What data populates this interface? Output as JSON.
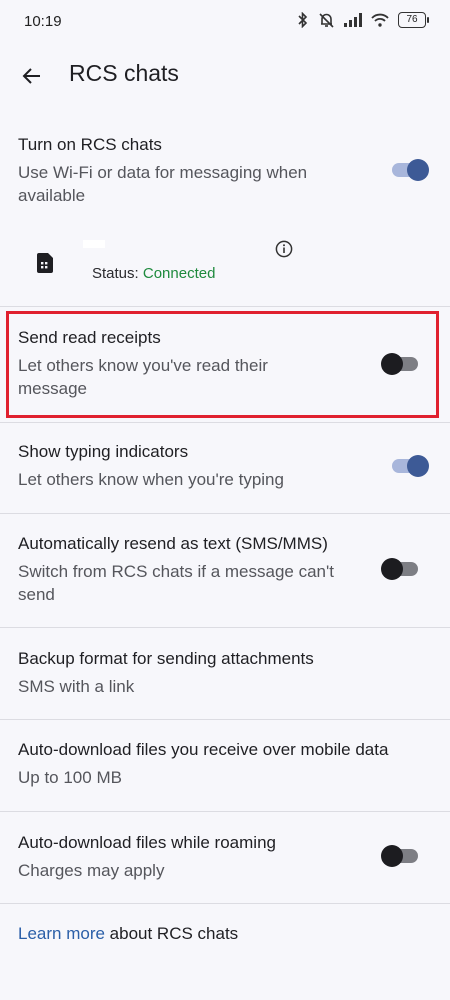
{
  "status_bar": {
    "time": "10:19",
    "battery": "76",
    "icons": [
      "bluetooth-icon",
      "mute-icon",
      "signal-icon",
      "wifi-icon",
      "battery-icon"
    ]
  },
  "appbar": {
    "back_icon": "arrow-back-icon",
    "title": "RCS chats"
  },
  "settings": {
    "rcs": {
      "title": "Turn on RCS chats",
      "subtitle": "Use Wi-Fi or data for messaging when available",
      "enabled": true
    },
    "sim": {
      "icon": "sim-card-icon",
      "status_label": "Status:",
      "status_value": "Connected",
      "info_icon": "info-icon"
    },
    "read_receipts": {
      "title": "Send read receipts",
      "subtitle": "Let others know you've read their message",
      "enabled": false
    },
    "typing": {
      "title": "Show typing indicators",
      "subtitle": "Let others know when you're typing",
      "enabled": true
    },
    "resend": {
      "title": "Automatically resend as text (SMS/MMS)",
      "subtitle": "Switch from RCS chats if a message can't send",
      "enabled": false
    },
    "backup": {
      "title": "Backup format for sending attachments",
      "subtitle": "SMS with a link"
    },
    "autodownload": {
      "title": "Auto-download files you receive over mobile data",
      "subtitle": "Up to 100 MB"
    },
    "roaming": {
      "title": "Auto-download files while roaming",
      "subtitle": "Charges may apply",
      "enabled": false
    }
  },
  "footer": {
    "link": "Learn more",
    "text": " about RCS chats"
  },
  "colors": {
    "background": "#f7f7fb",
    "toggle_on_thumb": "#3d5a96",
    "toggle_on_track": "#a8b6db",
    "toggle_off_thumb": "#1c1c20",
    "status_connected": "#1e8a3d",
    "link": "#2b5fa8",
    "highlight": "#e0202f"
  }
}
